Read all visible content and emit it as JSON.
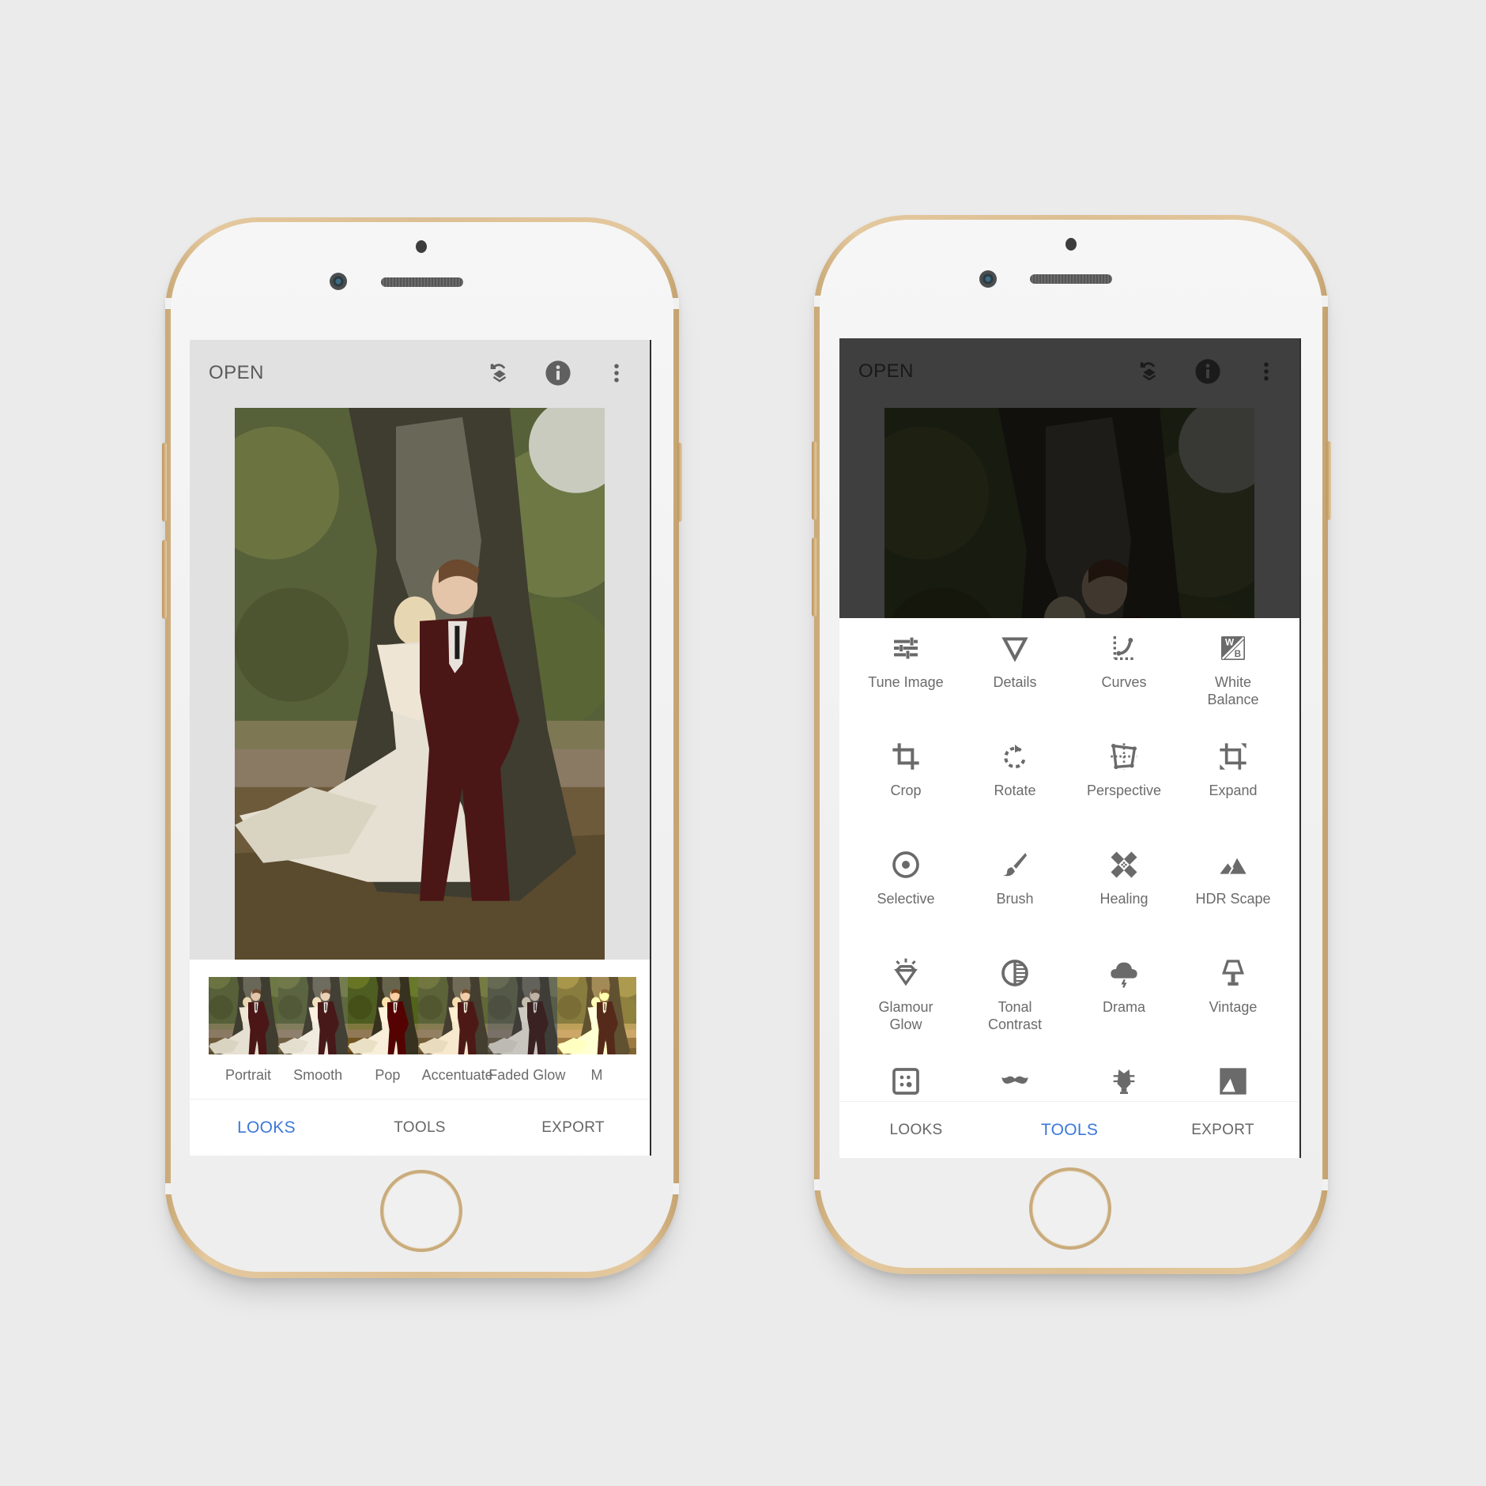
{
  "colors": {
    "background": "#ebebeb",
    "accent": "#3b78d8",
    "text_muted": "#6b6b6b",
    "gold_frame": "#dcbf93"
  },
  "left_phone": {
    "screen": "looks",
    "appbar": {
      "open_label": "OPEN",
      "icons": [
        "undo-layers-icon",
        "info-icon",
        "more-vert-icon"
      ]
    },
    "looks": [
      {
        "label": "Portrait",
        "tone": "natural"
      },
      {
        "label": "Smooth",
        "tone": "soft"
      },
      {
        "label": "Pop",
        "tone": "vivid"
      },
      {
        "label": "Accentuate",
        "tone": "warm"
      },
      {
        "label": "Faded Glow",
        "tone": "faded"
      },
      {
        "label": "M",
        "tone": "golden"
      }
    ],
    "tabs": [
      {
        "label": "LOOKS",
        "active": true
      },
      {
        "label": "TOOLS",
        "active": false
      },
      {
        "label": "EXPORT",
        "active": false
      }
    ]
  },
  "right_phone": {
    "screen": "tools",
    "appbar": {
      "open_label": "OPEN",
      "icons": [
        "undo-layers-icon",
        "info-icon",
        "more-vert-icon"
      ]
    },
    "tools": [
      {
        "label": "Tune Image",
        "icon": "tune-icon"
      },
      {
        "label": "Details",
        "icon": "details-triangle-icon"
      },
      {
        "label": "Curves",
        "icon": "curves-icon"
      },
      {
        "label": "White\nBalance",
        "icon": "white-balance-icon"
      },
      {
        "label": "Crop",
        "icon": "crop-icon"
      },
      {
        "label": "Rotate",
        "icon": "rotate-icon"
      },
      {
        "label": "Perspective",
        "icon": "perspective-icon"
      },
      {
        "label": "Expand",
        "icon": "expand-icon"
      },
      {
        "label": "Selective",
        "icon": "selective-icon"
      },
      {
        "label": "Brush",
        "icon": "brush-icon"
      },
      {
        "label": "Healing",
        "icon": "healing-bandage-icon"
      },
      {
        "label": "HDR Scape",
        "icon": "mountains-icon"
      },
      {
        "label": "Glamour\nGlow",
        "icon": "diamond-icon"
      },
      {
        "label": "Tonal\nContrast",
        "icon": "tonal-contrast-icon"
      },
      {
        "label": "Drama",
        "icon": "storm-cloud-icon"
      },
      {
        "label": "Vintage",
        "icon": "lamp-icon"
      },
      {
        "label": "",
        "icon": "grainy-film-icon"
      },
      {
        "label": "",
        "icon": "mustache-icon"
      },
      {
        "label": "",
        "icon": "guitar-head-icon"
      },
      {
        "label": "",
        "icon": "black-white-icon"
      }
    ],
    "tabs": [
      {
        "label": "LOOKS",
        "active": false
      },
      {
        "label": "TOOLS",
        "active": true
      },
      {
        "label": "EXPORT",
        "active": false
      }
    ]
  }
}
